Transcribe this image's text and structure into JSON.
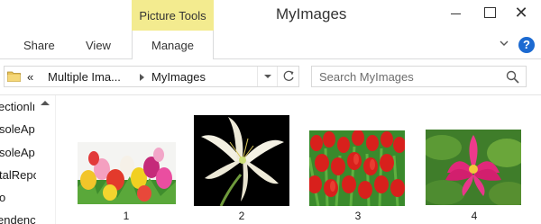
{
  "window": {
    "title": "MyImages",
    "context_tab_group": "Picture Tools",
    "close_symbol": "✕"
  },
  "ribbon": {
    "tabs": [
      "Share",
      "View",
      "Manage"
    ],
    "help_symbol": "?"
  },
  "address": {
    "overflow": "«",
    "crumbs": [
      "Multiple Ima...",
      "MyImages"
    ]
  },
  "search": {
    "placeholder": "Search MyImages"
  },
  "nav_pane": {
    "items": [
      "ectionlı",
      "soleAp",
      "soleAp",
      "talRepo",
      "o",
      "endenc"
    ]
  },
  "files": [
    {
      "label": "1",
      "icon": "tulips-thumbnail"
    },
    {
      "label": "2",
      "icon": "lily-thumbnail"
    },
    {
      "label": "3",
      "icon": "red-tulips-thumbnail"
    },
    {
      "label": "4",
      "icon": "lotus-thumbnail"
    }
  ],
  "colors": {
    "context_tab": "#f3eb8f",
    "help_blue": "#1c6ad1"
  }
}
